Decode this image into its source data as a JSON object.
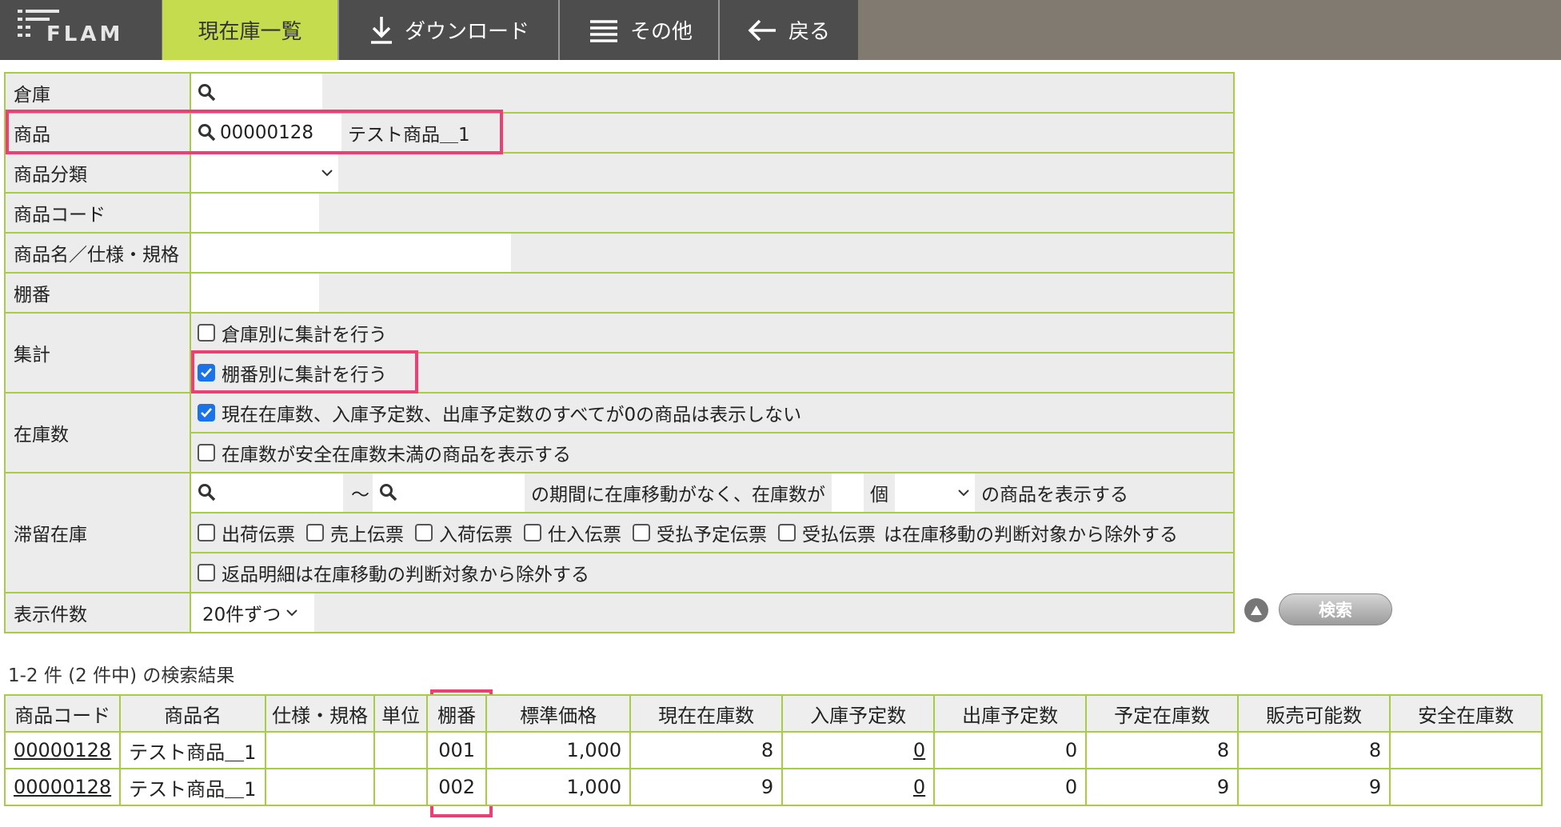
{
  "topbar": {
    "logo_text": "FLAM",
    "tabs": [
      {
        "label": "現在庫一覧",
        "active": true
      },
      {
        "label": "ダウンロード",
        "icon": "download-icon"
      },
      {
        "label": "その他",
        "icon": "menu-icon"
      },
      {
        "label": "戻る",
        "icon": "back-arrow-icon"
      }
    ]
  },
  "form": {
    "warehouse": {
      "label": "倉庫",
      "value": ""
    },
    "product": {
      "label": "商品",
      "code": "00000128",
      "name": "テスト商品＿1"
    },
    "category": {
      "label": "商品分類",
      "value": ""
    },
    "product_code": {
      "label": "商品コード",
      "value": ""
    },
    "product_name": {
      "label": "商品名／仕様・規格",
      "value": ""
    },
    "shelf": {
      "label": "棚番",
      "value": ""
    },
    "aggregate": {
      "label": "集計",
      "by_warehouse": {
        "text": "倉庫別に集計を行う",
        "checked": false
      },
      "by_shelf": {
        "text": "棚番別に集計を行う",
        "checked": true
      }
    },
    "stock": {
      "label": "在庫数",
      "hide_zero": {
        "text": "現在在庫数、入庫予定数、出庫予定数のすべてが0の商品は表示しない",
        "checked": true
      },
      "below_safety": {
        "text": "在庫数が安全在庫数未満の商品を表示する",
        "checked": false
      }
    },
    "stagnant": {
      "label": "滞留在庫",
      "tilde": "〜",
      "period_text": "の期間に在庫移動がなく、在庫数が",
      "unit": "個",
      "suffix": "の商品を表示する",
      "slips": [
        "出荷伝票",
        "売上伝票",
        "入荷伝票",
        "仕入伝票",
        "受払予定伝票",
        "受払伝票"
      ],
      "slips_suffix": "は在庫移動の判断対象から除外する",
      "returns": {
        "text": "返品明細は在庫移動の判断対象から除外する",
        "checked": false
      }
    },
    "page_size": {
      "label": "表示件数",
      "value": "20件ずつ"
    }
  },
  "search_button": "検索",
  "result_count": "1-2 件 (2 件中) の検索結果",
  "table": {
    "headers": [
      "商品コード",
      "商品名",
      "仕様・規格",
      "単位",
      "棚番",
      "標準価格",
      "現在在庫数",
      "入庫予定数",
      "出庫予定数",
      "予定在庫数",
      "販売可能数",
      "安全在庫数"
    ],
    "rows": [
      [
        "00000128",
        "テスト商品＿1",
        "",
        "",
        "001",
        "1,000",
        "8",
        "0",
        "0",
        "8",
        "8",
        ""
      ],
      [
        "00000128",
        "テスト商品＿1",
        "",
        "",
        "002",
        "1,000",
        "9",
        "0",
        "0",
        "9",
        "9",
        ""
      ]
    ]
  },
  "colors": {
    "accent": "#c5dc4f",
    "border": "#a8cc44",
    "highlight": "#ee3f75",
    "nav": "#4d4d4d",
    "topbar": "#807a70"
  }
}
